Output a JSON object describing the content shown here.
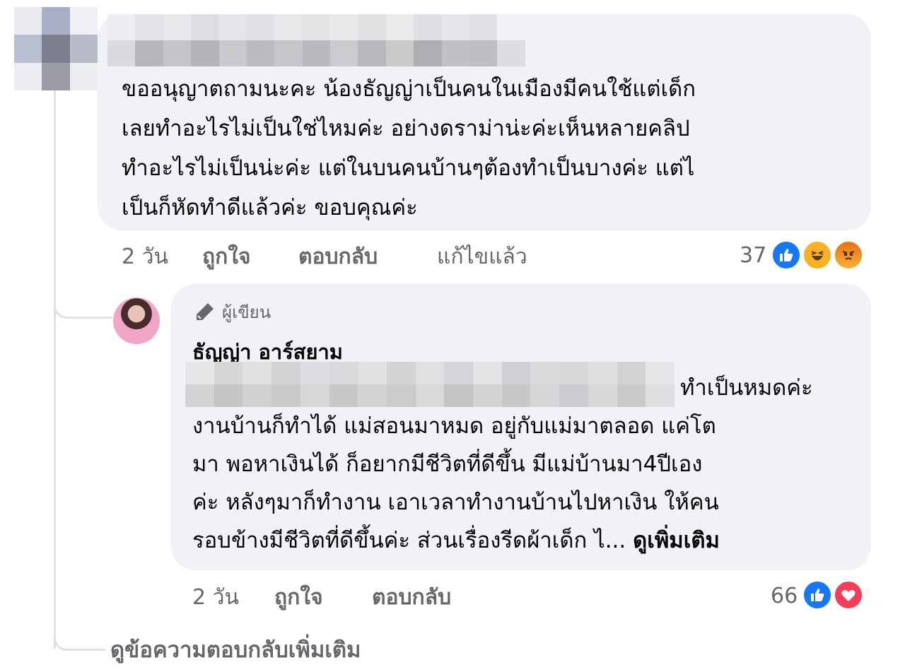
{
  "comment": {
    "text": "ขออนุญาตถามนะคะ น้องธัญญ่าเป็นคนในเมืองมีคนใช้แต่เด็ก\nเลยทำอะไรไม่เป็นใช่ไหมค่ะ อย่างดราม่าน่ะค่ะเห็นหลายคลิป\nทำอะไรไม่เป็นน่ะค่ะ แต่ในบนคนบ้านๆต้องทำเป็นบางค่ะ แต่ไ\nเป็นก็หัดทำดีแล้วค่ะ ขอบคุณค่ะ",
    "time": "2 วัน",
    "like_label": "ถูกใจ",
    "reply_label": "ตอบกลับ",
    "edited_label": "แก้ไขแล้ว",
    "reaction_count": "37",
    "reactions": [
      "like-icon",
      "haha-icon",
      "angry-icon"
    ]
  },
  "reply": {
    "author_badge": "ผู้เขียน",
    "author_name": "ธัญญ่า อาร์สยาม",
    "first_line_end": "ทำเป็นหมดค่ะ",
    "text": "งานบ้านก็ทำได้ แม่สอนมาหมด อยู่กับแม่มาตลอด แค่โต\nมา พอหาเงินได้ ก็อยากมีชีวิตที่ดีขึ้น มีแม่บ้านมา4ปีเอง\nค่ะ หลังๆมาก็ทำงาน เอาเวลาทำงานบ้านไปหาเงิน ให้คน\nรอบข้างมีชีวิตที่ดีขึ้นค่ะ ส่วนเรื่องรีดผ้าเด็ก ไ... ",
    "see_more": "ดูเพิ่มเติม",
    "time": "2 วัน",
    "like_label": "ถูกใจ",
    "reply_label": "ตอบกลับ",
    "reaction_count": "66",
    "reactions": [
      "like-icon",
      "love-icon"
    ]
  },
  "view_more_replies": "ดูข้อความตอบกลับเพิ่มเติม",
  "colors": {
    "bubble": "#f0f2f5",
    "meta_text": "#65676b",
    "like_blue": "#1877f2",
    "love_red": "#f33e58"
  }
}
